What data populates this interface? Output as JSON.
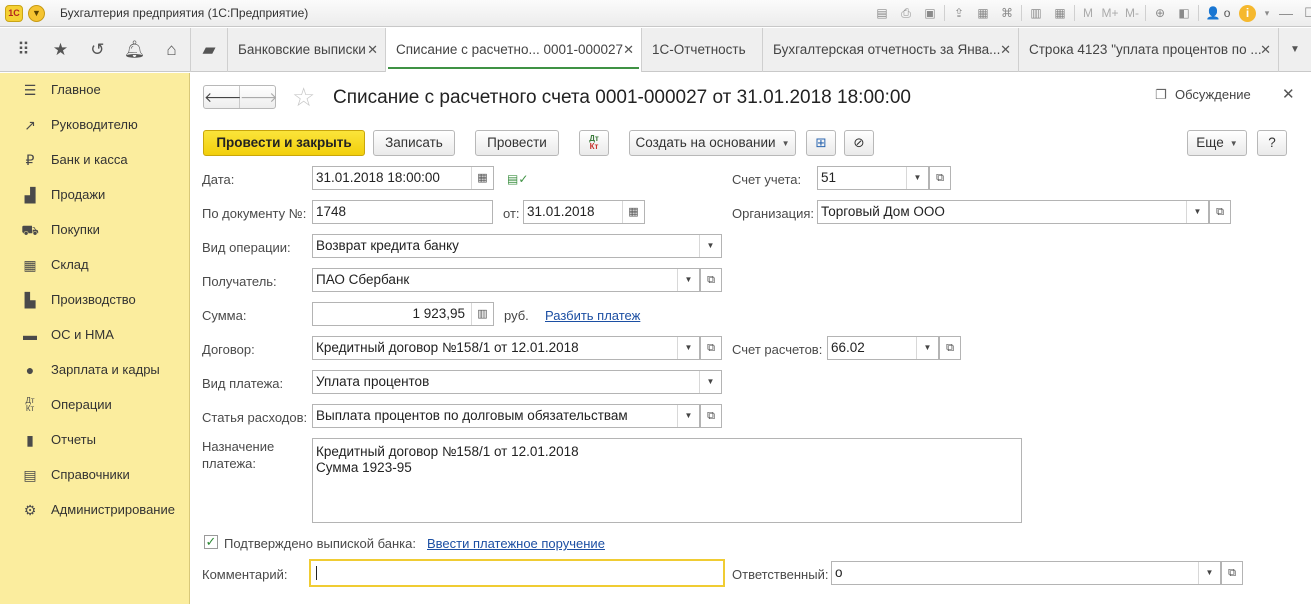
{
  "app": {
    "title": "Бухгалтерия предприятия  (1С:Предприятие)",
    "logo_text": "1С",
    "toolbar": {
      "m": "M",
      "m_plus": "M+",
      "m_minus": "M-",
      "user": "o",
      "info": "i"
    }
  },
  "tabs": [
    {
      "label": "Банковские выписки",
      "active": false
    },
    {
      "label": "Списание с расчетно...  0001-000027",
      "active": true
    },
    {
      "label": "1С-Отчетность",
      "active": false
    },
    {
      "label": "Бухгалтерская отчетность за Янва...",
      "active": false
    },
    {
      "label": "Строка 4123 \"уплата процентов по ...",
      "active": false
    }
  ],
  "sidebar": {
    "items": [
      {
        "label": "Главное",
        "icon": "menu-icon"
      },
      {
        "label": "Руководителю",
        "icon": "trend-icon"
      },
      {
        "label": "Банк и касса",
        "icon": "coin-icon"
      },
      {
        "label": "Продажи",
        "icon": "bag-icon"
      },
      {
        "label": "Покупки",
        "icon": "cart-icon"
      },
      {
        "label": "Склад",
        "icon": "warehouse-icon"
      },
      {
        "label": "Производство",
        "icon": "factory-icon"
      },
      {
        "label": "ОС и НМА",
        "icon": "truck-icon"
      },
      {
        "label": "Зарплата и кадры",
        "icon": "person-icon"
      },
      {
        "label": "Операции",
        "icon": "dt-kt-icon"
      },
      {
        "label": "Отчеты",
        "icon": "bar-chart-icon"
      },
      {
        "label": "Справочники",
        "icon": "book-icon"
      },
      {
        "label": "Администрирование",
        "icon": "gear-icon"
      }
    ]
  },
  "form": {
    "title": "Списание с расчетного счета 0001-000027 от 31.01.2018 18:00:00",
    "discussion": "Обсуждение",
    "commands": {
      "post_and_close": "Провести и закрыть",
      "save": "Записать",
      "post": "Провести",
      "dtkt_top": "Дт",
      "dtkt_bottom": "Кт",
      "create_based_on": "Создать на основании",
      "more": "Еще",
      "help": "?"
    },
    "fields": {
      "date_label": "Дата:",
      "date_value": "31.01.2018 18:00:00",
      "doc_number_label": "По документу №:",
      "doc_number_value": "1748",
      "from_label": "от:",
      "from_value": "31.01.2018",
      "operation_label": "Вид операции:",
      "operation_value": "Возврат кредита банку",
      "recipient_label": "Получатель:",
      "recipient_value": "ПАО Сбербанк",
      "amount_label": "Сумма:",
      "amount_value": "1 923,95",
      "currency": "руб.",
      "split_payment": "Разбить платеж",
      "contract_label": "Договор:",
      "contract_value": "Кредитный договор №158/1 от 12.01.2018",
      "payment_type_label": "Вид платежа:",
      "payment_type_value": "Уплата процентов",
      "expense_label": "Статья расходов:",
      "expense_value": "Выплата процентов по долговым обязательствам",
      "purpose_label_1": "Назначение",
      "purpose_label_2": "платежа:",
      "purpose_line_1": "Кредитный договор №158/1 от 12.01.2018",
      "purpose_line_2": "Сумма 1923-95",
      "account_label": "Счет учета:",
      "account_value": "51",
      "org_label": "Организация:",
      "org_value": "Торговый Дом ООО",
      "settlement_label": "Счет расчетов:",
      "settlement_value": "66.02",
      "confirmed_label": "Подтверждено выпиской банка:",
      "confirmed_checked": true,
      "enter_order": "Ввести платежное поручение",
      "comment_label": "Комментарий:",
      "comment_value": "",
      "responsible_label": "Ответственный:",
      "responsible_value": "о"
    }
  }
}
